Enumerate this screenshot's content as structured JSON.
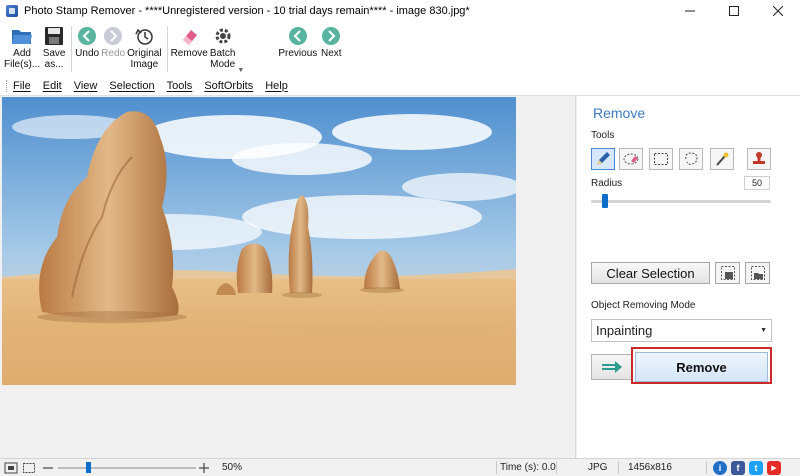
{
  "window": {
    "title": "Photo Stamp Remover - ****Unregistered version - 10 trial days remain**** - image 830.jpg*"
  },
  "toolbar": {
    "add_files": "Add\nFile(s)...",
    "save_as": "Save\nas...",
    "undo": "Undo",
    "redo": "Redo",
    "original_image": "Original\nImage",
    "remove": "Remove",
    "batch_mode": "Batch\nMode",
    "previous": "Previous",
    "next": "Next"
  },
  "menu": [
    "File",
    "Edit",
    "View",
    "Selection",
    "Tools",
    "SoftOrbits",
    "Help"
  ],
  "panel": {
    "title": "Remove",
    "tools_label": "Tools",
    "radius_label": "Radius",
    "radius_value": "50",
    "radius_fraction": 0.08,
    "clear_selection": "Clear Selection",
    "mode_label": "Object Removing Mode",
    "mode_value": "Inpainting",
    "remove_button": "Remove"
  },
  "status": {
    "zoom": "50%",
    "zoom_fraction": 0.22,
    "time": "Time (s): 0.0",
    "format": "JPG",
    "dimensions": "1456x816",
    "facebook": "f",
    "twitter": "t",
    "youtube": "▶"
  },
  "colors": {
    "accent": "#3a79c0",
    "highlight": "#cc2a2a",
    "slider": "#0d6ec9"
  },
  "icons": {
    "pencil": "pencil-icon",
    "eraser": "eraser-icon",
    "rect_select": "rectangle-select-icon",
    "lasso": "lasso-icon",
    "magic_wand": "magic-wand-icon",
    "stamp": "stamp-icon"
  }
}
